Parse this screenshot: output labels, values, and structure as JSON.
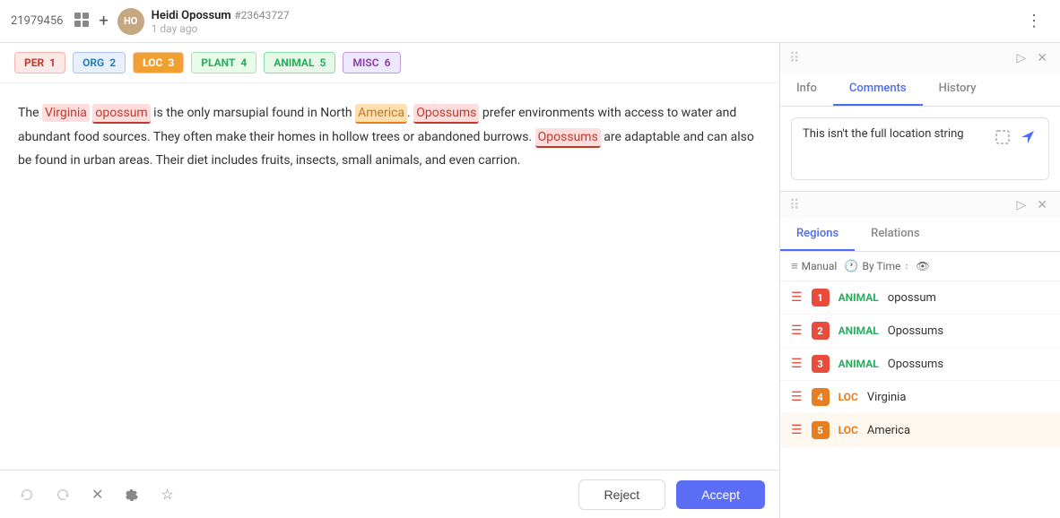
{
  "header": {
    "id": "21979456",
    "user_name": "Heidi Opossum",
    "user_id": "#23643727",
    "time_ago": "1 day ago"
  },
  "tag_bar": {
    "tags": [
      {
        "label": "PER",
        "count": "1",
        "type": "per"
      },
      {
        "label": "ORG",
        "count": "2",
        "type": "org"
      },
      {
        "label": "LOC",
        "count": "3",
        "type": "loc"
      },
      {
        "label": "PLANT",
        "count": "4",
        "type": "plant"
      },
      {
        "label": "ANIMAL",
        "count": "5",
        "type": "animal"
      },
      {
        "label": "MISC",
        "count": "6",
        "type": "misc"
      }
    ]
  },
  "main_text": {
    "sentence1_pre": "The ",
    "span_virginia": "Virginia",
    "sentence1_mid1": " ",
    "span_opossum": "opossum",
    "sentence1_mid2": " is the only marsupial found in North ",
    "span_america": "America",
    "sentence1_end": ". ",
    "span_opossums1": "Opossums",
    "sentence1_rest": " prefer environments with access to water and abundant food sources. They often make their homes in hollow trees or abandoned burrows. ",
    "span_opossums2": "Opossums",
    "sentence2": " are adaptable and can also be found in urban areas. Their diet includes fruits, insects, small animals, and even carrion."
  },
  "right_panel": {
    "tabs": [
      "Info",
      "Comments",
      "History"
    ],
    "active_tab": "Comments",
    "comment_placeholder": "This isn't the full location string",
    "comment_text": "This isn't the full location string"
  },
  "bottom_panel": {
    "tabs": [
      "Regions",
      "Relations"
    ],
    "active_tab": "Regions",
    "filter": {
      "manual_label": "Manual",
      "by_time_label": "By Time"
    },
    "regions": [
      {
        "num": "1",
        "type": "ANIMAL",
        "value": "opossum",
        "color": "red"
      },
      {
        "num": "2",
        "type": "ANIMAL",
        "value": "Opossums",
        "color": "red"
      },
      {
        "num": "3",
        "type": "ANIMAL",
        "value": "Opossums",
        "color": "red"
      },
      {
        "num": "4",
        "type": "LOC",
        "value": "Virginia",
        "color": "orange"
      },
      {
        "num": "5",
        "type": "LOC",
        "value": "America",
        "color": "orange"
      }
    ]
  },
  "toolbar": {
    "undo_label": "↩",
    "redo_label": "↪",
    "close_label": "✕",
    "settings_label": "⚙",
    "star_label": "☆",
    "reject_label": "Reject",
    "accept_label": "Accept"
  }
}
